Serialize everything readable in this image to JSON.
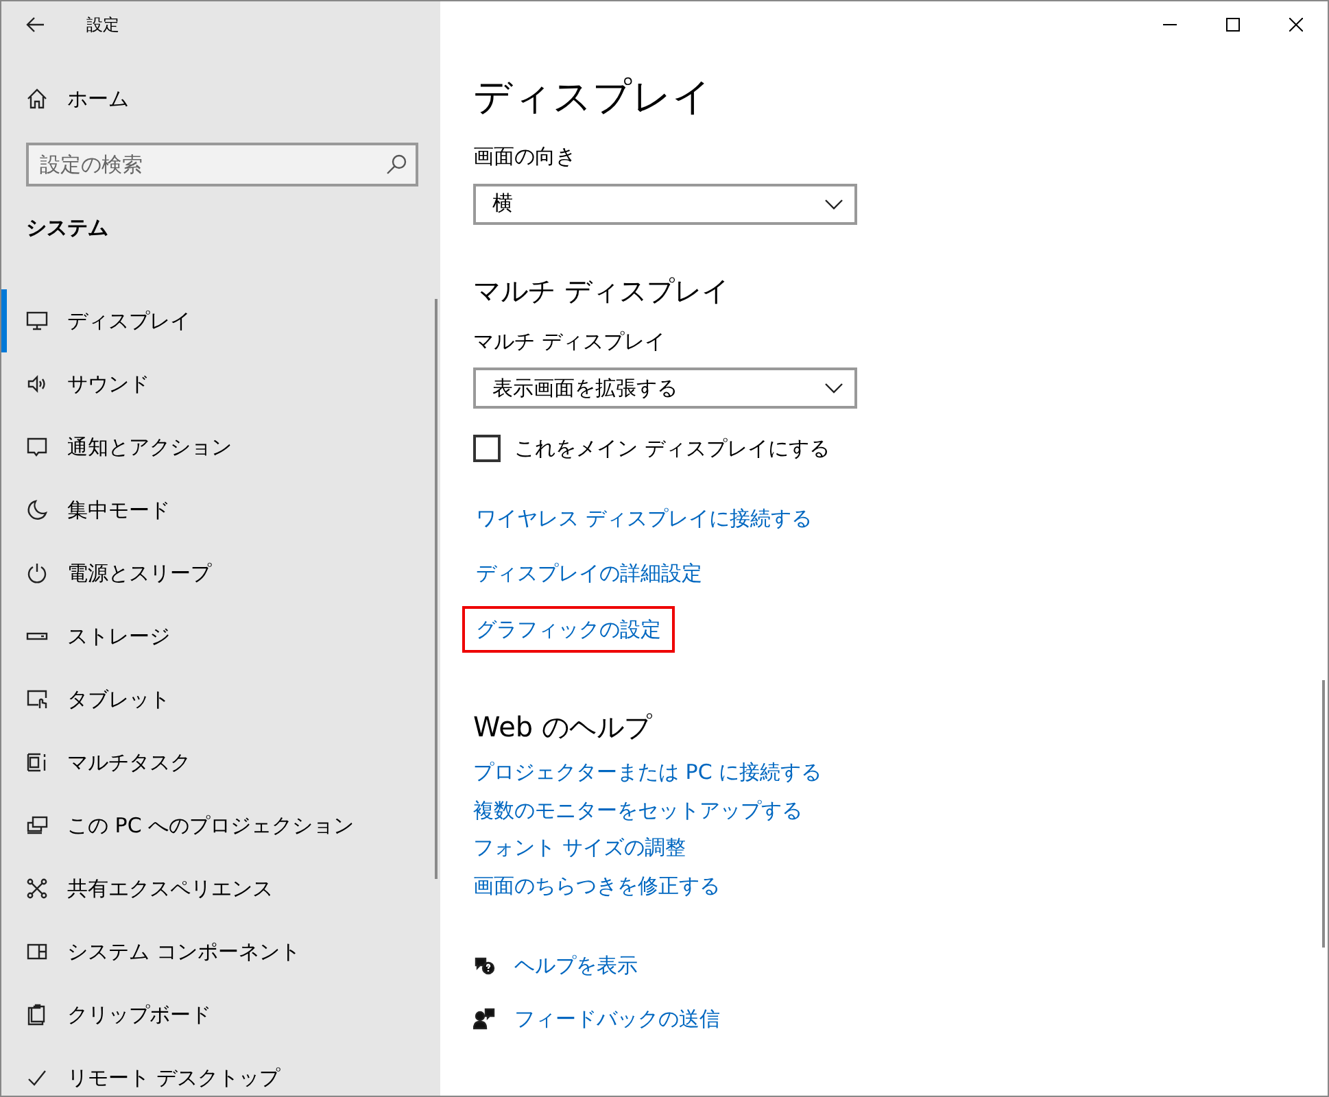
{
  "window": {
    "title": "設定"
  },
  "sidebar": {
    "home": "ホーム",
    "search": {
      "placeholder": "設定の検索"
    },
    "section": "システム",
    "items": [
      {
        "label": "ディスプレイ",
        "selected": true
      },
      {
        "label": "サウンド",
        "selected": false
      },
      {
        "label": "通知とアクション",
        "selected": false
      },
      {
        "label": "集中モード",
        "selected": false
      },
      {
        "label": "電源とスリープ",
        "selected": false
      },
      {
        "label": "ストレージ",
        "selected": false
      },
      {
        "label": "タブレット",
        "selected": false
      },
      {
        "label": "マルチタスク",
        "selected": false
      },
      {
        "label": "この PC へのプロジェクション",
        "selected": false
      },
      {
        "label": "共有エクスペリエンス",
        "selected": false
      },
      {
        "label": "システム コンポーネント",
        "selected": false
      },
      {
        "label": "クリップボード",
        "selected": false
      },
      {
        "label": "リモート デスクトップ",
        "selected": false
      }
    ]
  },
  "main": {
    "title": "ディスプレイ",
    "orientation": {
      "label": "画面の向き",
      "value": "横"
    },
    "multi_heading": "マルチ ディスプレイ",
    "multi": {
      "label": "マルチ ディスプレイ",
      "value": "表示画面を拡張する"
    },
    "main_display": {
      "label": "これをメイン ディスプレイにする",
      "checked": false
    },
    "links": [
      {
        "label": "ワイヤレス ディスプレイに接続する",
        "highlighted": false
      },
      {
        "label": "ディスプレイの詳細設定",
        "highlighted": false
      },
      {
        "label": "グラフィックの設定",
        "highlighted": true
      }
    ],
    "help": {
      "heading": "Web のヘルプ",
      "links": [
        "プロジェクターまたは PC に接続する",
        "複数のモニターをセットアップする",
        "フォント サイズの調整",
        "画面のちらつきを修正する"
      ]
    },
    "footer": [
      {
        "label": "ヘルプを表示"
      },
      {
        "label": "フィードバックの送信"
      }
    ]
  }
}
